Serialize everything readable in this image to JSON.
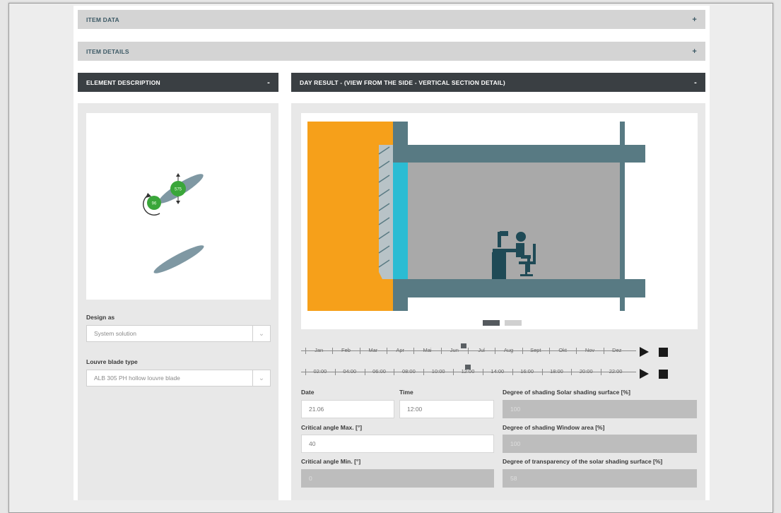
{
  "sections": {
    "item_data": "ITEM DATA",
    "item_details": "ITEM DETAILS",
    "element_description": "ELEMENT DESCRIPTION",
    "day_result": "DAY RESULT - (VIEW FROM THE SIDE - VERTICAL SECTION DETAIL)",
    "expand_symbol": "+",
    "collapse_symbol": "-"
  },
  "blade_diagram": {
    "handle_1": "96",
    "handle_2": "575"
  },
  "form": {
    "design_as_label": "Design as",
    "design_as_value": "System solution",
    "louvre_label": "Louvre blade type",
    "louvre_value": "ALB 305 PH hollow louvre blade"
  },
  "months": [
    "Jan",
    "Feb",
    "Mar",
    "Apr",
    "Mai",
    "Jun",
    "Jul",
    "Aug",
    "Sept",
    "Okt",
    "Nov",
    "Dez"
  ],
  "month_position": 5.35,
  "hours": [
    "02:00",
    "04:00",
    "06:00",
    "08:00",
    "10:00",
    "12:00",
    "14:00",
    "16:00",
    "18:00",
    "20:00",
    "22:00"
  ],
  "hour_position": 5.0,
  "slides": {
    "count": 2,
    "active": 0
  },
  "results": {
    "date_label": "Date",
    "date_value": "21.06",
    "time_label": "Time",
    "time_value": "12:00",
    "crit_max_label": "Critical angle Max. [°]",
    "crit_max_value": "40",
    "crit_min_label": "Critical angle Min. [°]",
    "crit_min_value": "0",
    "shading_surface_label": "Degree of shading Solar shading surface [%]",
    "shading_surface_value": "100",
    "shading_window_label": "Degree of shading Window area [%]",
    "shading_window_value": "100",
    "transparency_label": "Degree of transparency of the solar shading surface [%]",
    "transparency_value": "58"
  },
  "colors": {
    "facade": "#f6a01a",
    "glass": "#2bbcd3",
    "structure": "#587a83",
    "room": "#a9a9a9",
    "handle": "#3aa63a",
    "blade": "#7f98a3"
  }
}
